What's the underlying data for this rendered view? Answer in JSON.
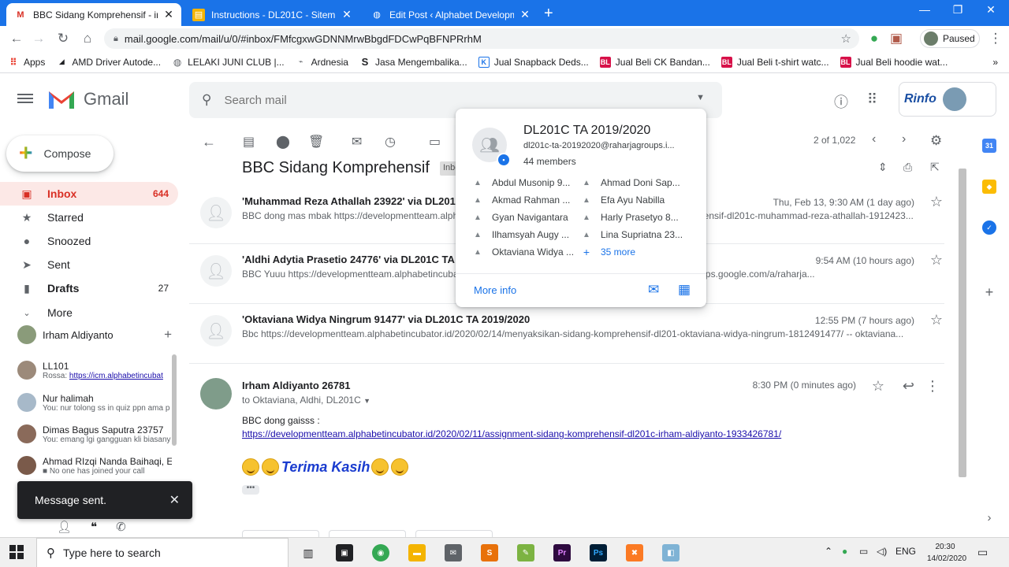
{
  "browser": {
    "tabs": [
      {
        "title": "BBC Sidang Komprehensif - irhar",
        "icon": "gmail-icon",
        "active": true
      },
      {
        "title": "Instructions - DL201C - Sitem Ba",
        "icon": "docs-icon",
        "active": false
      },
      {
        "title": "Edit Post ‹ Alphabet Developmen",
        "icon": "wordpress-icon",
        "active": false
      }
    ],
    "url": "mail.google.com/mail/u/0/#inbox/FMfcgxwGDNNMrwBbgdFDCwPqBFNPRrhM",
    "profile_status": "Paused",
    "bookmarks": [
      {
        "label": "Apps",
        "icon": "apps-grid-icon",
        "color": "#ea4335"
      },
      {
        "label": "AMD Driver Autode...",
        "icon": "amd-icon",
        "color": "#202124"
      },
      {
        "label": "LELAKI JUNI CLUB |...",
        "icon": "globe-icon",
        "color": "#5f6368"
      },
      {
        "label": "Ardnesia",
        "icon": "ardnesia-icon",
        "color": "#5f6368"
      },
      {
        "label": "Jasa Mengembalika...",
        "icon": "s-logo-icon",
        "color": "#202124"
      },
      {
        "label": "Jual Snapback Deds...",
        "icon": "k-logo-icon",
        "color": "#1a73e8"
      },
      {
        "label": "Jual Beli CK Bandan...",
        "icon": "bl-logo-icon",
        "color": "#d71149"
      },
      {
        "label": "Jual Beli t-shirt watc...",
        "icon": "bl-logo-icon",
        "color": "#d71149"
      },
      {
        "label": "Jual Beli hoodie wat...",
        "icon": "bl-logo-icon",
        "color": "#d71149"
      }
    ]
  },
  "gmail": {
    "app_name": "Gmail",
    "search_placeholder": "Search mail",
    "compose_label": "Compose",
    "account_brand": "Rinfo",
    "nav": [
      {
        "label": "Inbox",
        "count": "644",
        "icon": "inbox-icon",
        "active": true
      },
      {
        "label": "Starred",
        "count": "",
        "icon": "star-icon",
        "active": false
      },
      {
        "label": "Snoozed",
        "count": "",
        "icon": "clock-icon",
        "active": false
      },
      {
        "label": "Sent",
        "count": "",
        "icon": "send-icon",
        "active": false
      },
      {
        "label": "Drafts",
        "count": "27",
        "icon": "draft-icon",
        "active": false
      },
      {
        "label": "More",
        "count": "",
        "icon": "chevron-down-icon",
        "active": false
      }
    ],
    "hangouts_user": "Irham Aldiyanto",
    "chats": [
      {
        "name": "LL101",
        "prefix": "Rossa: ",
        "link": "https://icm.alphabetincubat",
        "sub": ""
      },
      {
        "name": "Nur halimah",
        "prefix": "",
        "link": "",
        "sub": "You: nur tolong ss in quiz ppn ama p"
      },
      {
        "name": "Dimas Bagus Saputra 23757",
        "prefix": "",
        "link": "",
        "sub": "You: emang lgi gangguan kli biasany"
      },
      {
        "name": "Ahmad RIzqi Nanda Baihaqi, E",
        "prefix": "",
        "link": "",
        "sub": "No one has joined your call"
      }
    ],
    "toast": "Message sent.",
    "pager": "2 of 1,022",
    "subject": "BBC Sidang Komprehensif",
    "label_tag": "Inbox",
    "messages": [
      {
        "from": "'Muhammad Reza Athallah 23922' via DL201C TA 2019/2020",
        "snippet": "BBC dong mas mbak https://developmentteam.alphabetincubator.id/2020/02/12/menyaksikan-sidang-komprehensif-dl201c-muhammad-reza-athallah-1912423...",
        "time": "Thu, Feb 13, 9:30 AM (1 day ago)"
      },
      {
        "from": "'Aldhi Adytia Prasetio 24776' via DL201C TA 2019/2020",
        "snippet": "BBC Yuuu https://developmentteam.alphabetincubator.id/... To view this discussion on the web visit https://groups.google.com/a/raharja...",
        "time": "9:54 AM (10 hours ago)"
      },
      {
        "from": "'Oktaviana Widya Ningrum 91477' via DL201C TA 2019/2020",
        "snippet": "Bbc https://developmentteam.alphabetincubator.id/2020/02/14/menyaksikan-sidang-komprehensif-dl201-oktaviana-widya-ningrum-1812491477/ -- oktaviana...",
        "time": "12:55 PM (7 hours ago)"
      }
    ],
    "open_message": {
      "from": "Irham Aldiyanto 26781",
      "to": "to Oktaviana, Aldhi, DL201C",
      "time": "8:30 PM (0 minutes ago)",
      "body": "BBC dong gaisss :",
      "link": "https://developmentteam.alphabetincubator.id/2020/02/11/assignment-sidang-komprehensif-dl201c-irham-aldiyanto-1933426781/",
      "closing": "Terima Kasih"
    }
  },
  "group_card": {
    "name": "DL201C TA 2019/2020",
    "email": "dl201c-ta-20192020@raharjagroups.i...",
    "members_count": "44 members",
    "members": [
      "Abdul Musonip 9...",
      "Ahmad Doni Sap...",
      "Akmad Rahman ...",
      "Efa Ayu Nabilla",
      "Gyan Navigantara",
      "Harly Prasetyo 8...",
      "Ilhamsyah Augy ...",
      "Lina Supriatna 23...",
      "Oktaviana Widya ..."
    ],
    "more": "35 more",
    "more_info": "More info"
  },
  "taskbar": {
    "search_placeholder": "Type here to search",
    "language": "ENG",
    "time": "20:30",
    "date": "14/02/2020"
  },
  "colors": {
    "chrome_blue": "#1a73e8",
    "gmail_red": "#d93025",
    "inbox_highlight": "#fce8e6",
    "link_blue": "#1a0dab"
  }
}
